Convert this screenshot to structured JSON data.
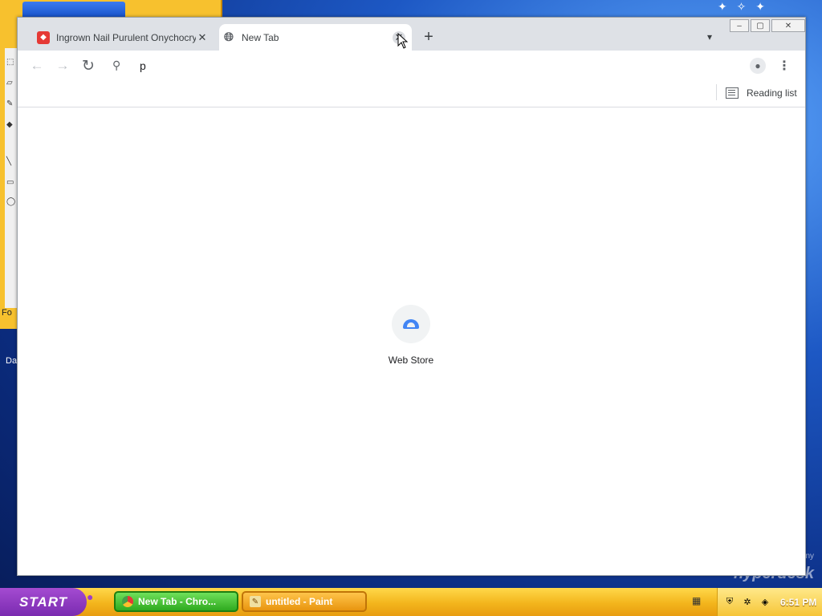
{
  "chrome": {
    "tabs": [
      {
        "title": "Ingrown Nail Purulent Onychocryptosis",
        "favicon": "red-app-icon"
      },
      {
        "title": "New Tab",
        "favicon": "globe-icon"
      }
    ],
    "new_tab_symbol": "+",
    "tab_search_symbol": "⌄",
    "window_controls": {
      "minimize": "‒",
      "maximize": "▢",
      "close": "✕"
    },
    "toolbar": {
      "back_symbol": "←",
      "forward_symbol": "→",
      "reload_symbol": "↻",
      "search_symbol": "⌕",
      "omnibox_value": "p",
      "menu_symbol": "⋮"
    },
    "bookmarks": {
      "reading_list_label": "Reading list"
    },
    "new_tab_page": {
      "shortcuts": [
        {
          "label": "Web Store"
        }
      ]
    }
  },
  "background": {
    "paint_fo_label": "Fo",
    "desktop_label": "Da",
    "brand_small": "ny",
    "brand": "hyperdesk"
  },
  "taskbar": {
    "start_label": "START",
    "tasks": [
      {
        "label": "New Tab - Chro...",
        "icon": "chrome-icon"
      },
      {
        "label": "untitled - Paint",
        "icon": "paint-icon"
      }
    ],
    "clock": "6:51 PM"
  },
  "colors": {
    "tabstrip": "#dee1e6",
    "taskbar": "#f3b51c",
    "start": "#7a2bb0",
    "task_active": "#2faa1f"
  }
}
